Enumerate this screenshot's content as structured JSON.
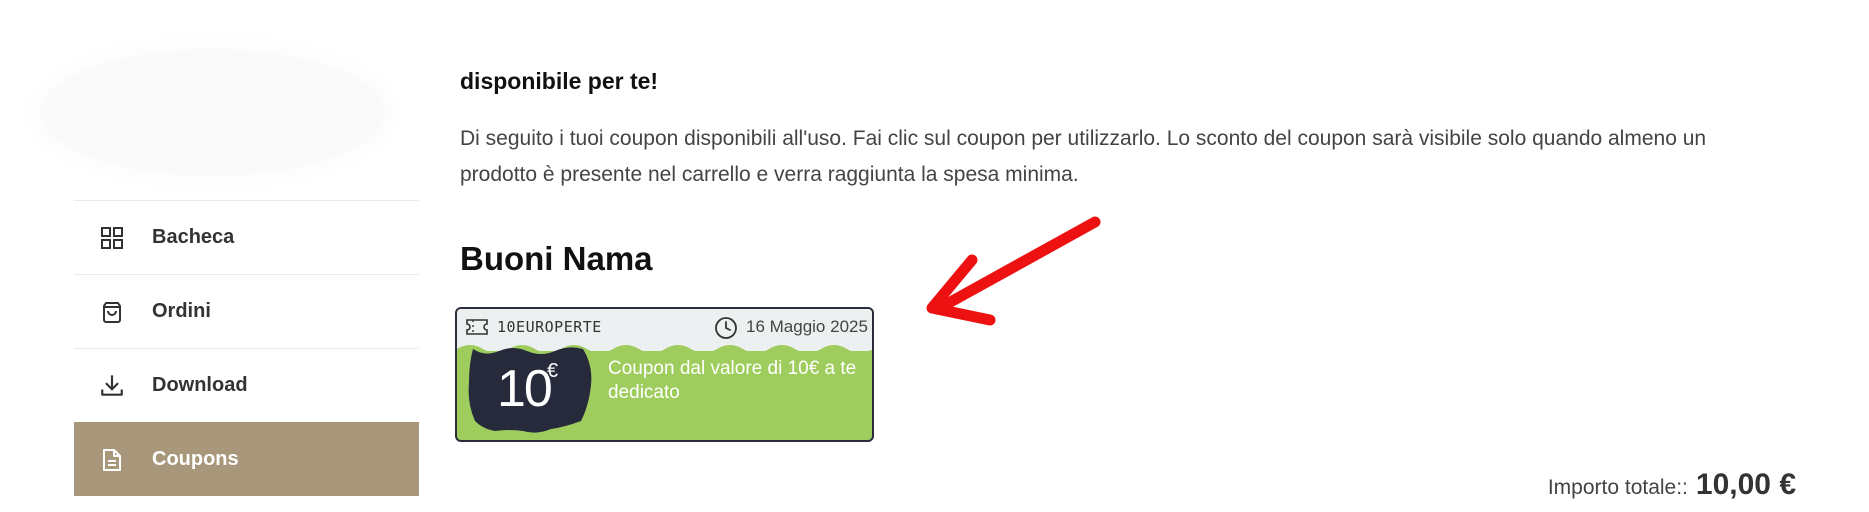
{
  "sidebar": {
    "items": [
      {
        "label": "Bacheca",
        "icon": "grid-icon",
        "active": false
      },
      {
        "label": "Ordini",
        "icon": "shopping-bag-icon",
        "active": false
      },
      {
        "label": "Download",
        "icon": "download-icon",
        "active": false
      },
      {
        "label": "Coupons",
        "icon": "document-icon",
        "active": true
      }
    ]
  },
  "main": {
    "heading": "disponibile per te!",
    "description": "Di seguito i tuoi coupon disponibili all'uso. Fai clic sul coupon per utilizzarlo. Lo sconto del coupon sarà visibile solo quando almeno un prodotto è presente nel carrello e verra raggiunta la spesa minima.",
    "section_title": "Buoni Nama"
  },
  "coupon": {
    "code": "10EUROPERTE",
    "date": "16 Maggio 2025",
    "amount": "10",
    "currency": "€",
    "text": "Coupon dal valore di 10€ a te dedicato"
  },
  "total": {
    "label": "Importo totale::",
    "value": "10,00 €"
  },
  "colors": {
    "active_nav": "#a8977a",
    "coupon_green": "#9fcd5d",
    "coupon_badge": "#262a3b",
    "arrow_red": "#ee1111"
  }
}
